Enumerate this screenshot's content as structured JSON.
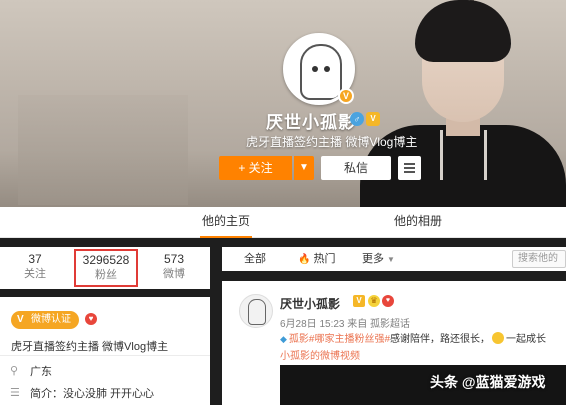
{
  "profile": {
    "name": "厌世小孤影",
    "description": "虎牙直播签约主播 微博Vlog博主",
    "follow_label": "+ 关注",
    "message_label": "私信"
  },
  "tabs": [
    {
      "label": "他的主页",
      "active": true
    },
    {
      "label": "他的相册",
      "active": false
    }
  ],
  "stats": [
    {
      "value": "37",
      "label": "关注"
    },
    {
      "value": "3296528",
      "label": "粉丝",
      "highlighted": true
    },
    {
      "value": "573",
      "label": "微博"
    }
  ],
  "info": {
    "verify_label": "微博认证",
    "description": "虎牙直播签约主播 微博Vlog博主",
    "location": "广东",
    "bio": "简介：没心没肺 开开心心"
  },
  "filters": {
    "all": "全部",
    "hot": "热门",
    "more": "更多",
    "search_placeholder": "搜索他的"
  },
  "post": {
    "author": "厌世小孤影",
    "meta": "6月28日 15:23 来自 孤影超话",
    "text_prefix": "孤影",
    "topic": "#哪家主播粉丝强#",
    "text": "感谢陪伴，路还很长，",
    "text_suffix": "一起成长",
    "video_link": "小孤影的微博视频"
  },
  "watermark": "头条 @蓝猫爱游戏",
  "colors": {
    "accent": "#ff8200",
    "highlight_box": "#e03b36",
    "link": "#eb7350"
  }
}
